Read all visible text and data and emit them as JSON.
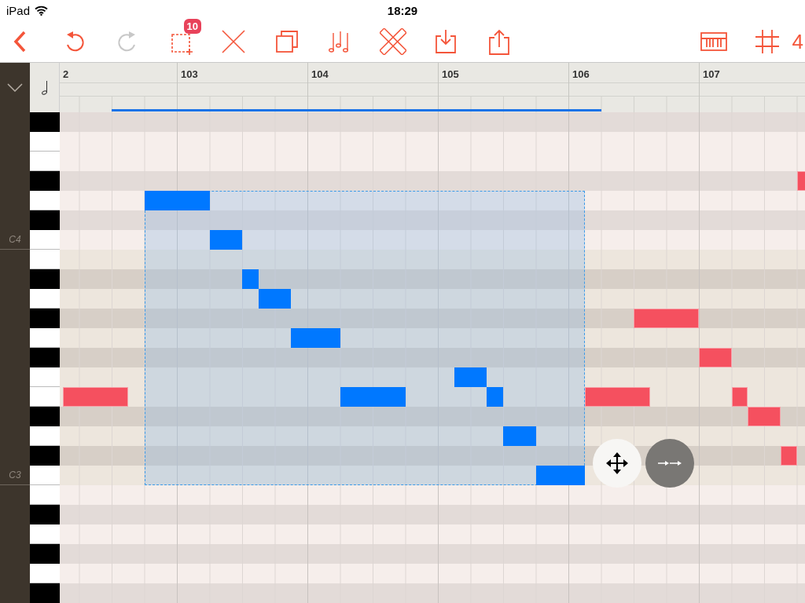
{
  "status_bar": {
    "carrier": "iPad",
    "time": "18:29"
  },
  "toolbar": {
    "left_buttons": [
      {
        "kind": "back",
        "disabled": false
      },
      {
        "kind": "undo",
        "disabled": false
      },
      {
        "kind": "redo",
        "disabled": true
      },
      {
        "kind": "select",
        "disabled": false,
        "badge": "10"
      },
      {
        "kind": "delete",
        "disabled": false
      },
      {
        "kind": "duplicate",
        "disabled": false
      },
      {
        "kind": "notes",
        "disabled": false
      },
      {
        "kind": "tools",
        "disabled": false
      },
      {
        "kind": "import",
        "disabled": false
      },
      {
        "kind": "share",
        "disabled": false
      }
    ],
    "right_buttons": [
      {
        "kind": "piano",
        "disabled": false
      },
      {
        "kind": "grid",
        "disabled": false
      }
    ],
    "cut_label": "4"
  },
  "ruler": {
    "bars": [
      "2",
      "103",
      "104",
      "105",
      "106",
      "107"
    ]
  },
  "keyboard": {
    "labels": [
      "C4",
      "C3"
    ]
  },
  "notes": [
    {
      "selected": true
    },
    {
      "selected": true
    },
    {
      "selected": true
    },
    {
      "selected": true
    },
    {
      "selected": true
    },
    {
      "selected": true
    },
    {
      "selected": true
    },
    {
      "selected": true
    },
    {
      "selected": true
    },
    {
      "selected": true
    },
    {
      "selected": false
    },
    {
      "selected": false
    },
    {
      "selected": false
    },
    {
      "selected": false
    },
    {
      "selected": false
    },
    {
      "selected": false
    },
    {
      "selected": false
    },
    {
      "selected": false
    }
  ]
}
